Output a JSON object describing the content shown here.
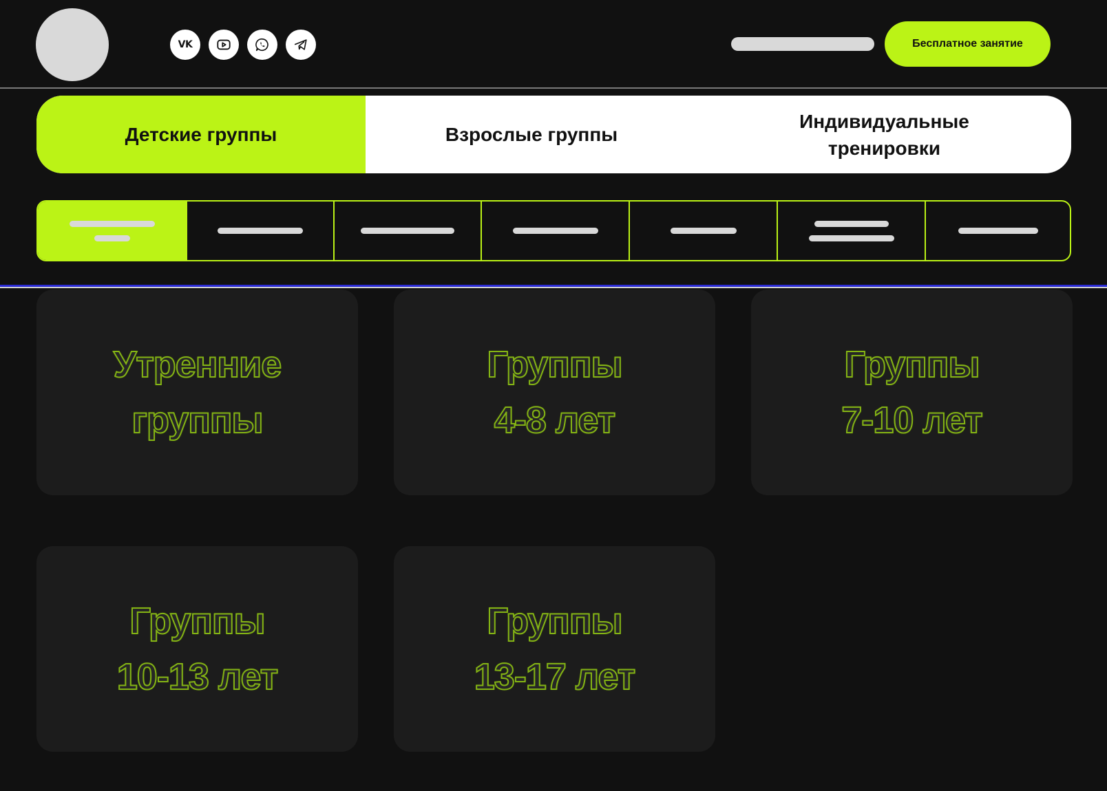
{
  "header": {
    "socials": [
      {
        "icon": "vk-icon",
        "label": "VK"
      },
      {
        "icon": "youtube-icon"
      },
      {
        "icon": "whatsapp-icon"
      },
      {
        "icon": "telegram-icon"
      }
    ],
    "cta_label": "Бесплатное занятие"
  },
  "tabs": [
    {
      "label": "Детские группы",
      "active": true
    },
    {
      "label": "Взрослые группы",
      "active": false
    },
    {
      "label": "Индивидуальные\nтренировки",
      "active": false
    }
  ],
  "cards": [
    {
      "line1": "Утренние",
      "line2": "группы"
    },
    {
      "line1": "Группы",
      "line2": "4-8 лет"
    },
    {
      "line1": "Группы",
      "line2": "7-10 лет"
    },
    {
      "line1": "Группы",
      "line2": "10-13 лет"
    },
    {
      "line1": "Группы",
      "line2": "13-17 лет"
    }
  ],
  "colors": {
    "accent": "#bbf316",
    "background": "#111111",
    "card": "#1c1c1c",
    "card_outline_text": "#84b414",
    "placeholder": "#d9d9d9"
  }
}
